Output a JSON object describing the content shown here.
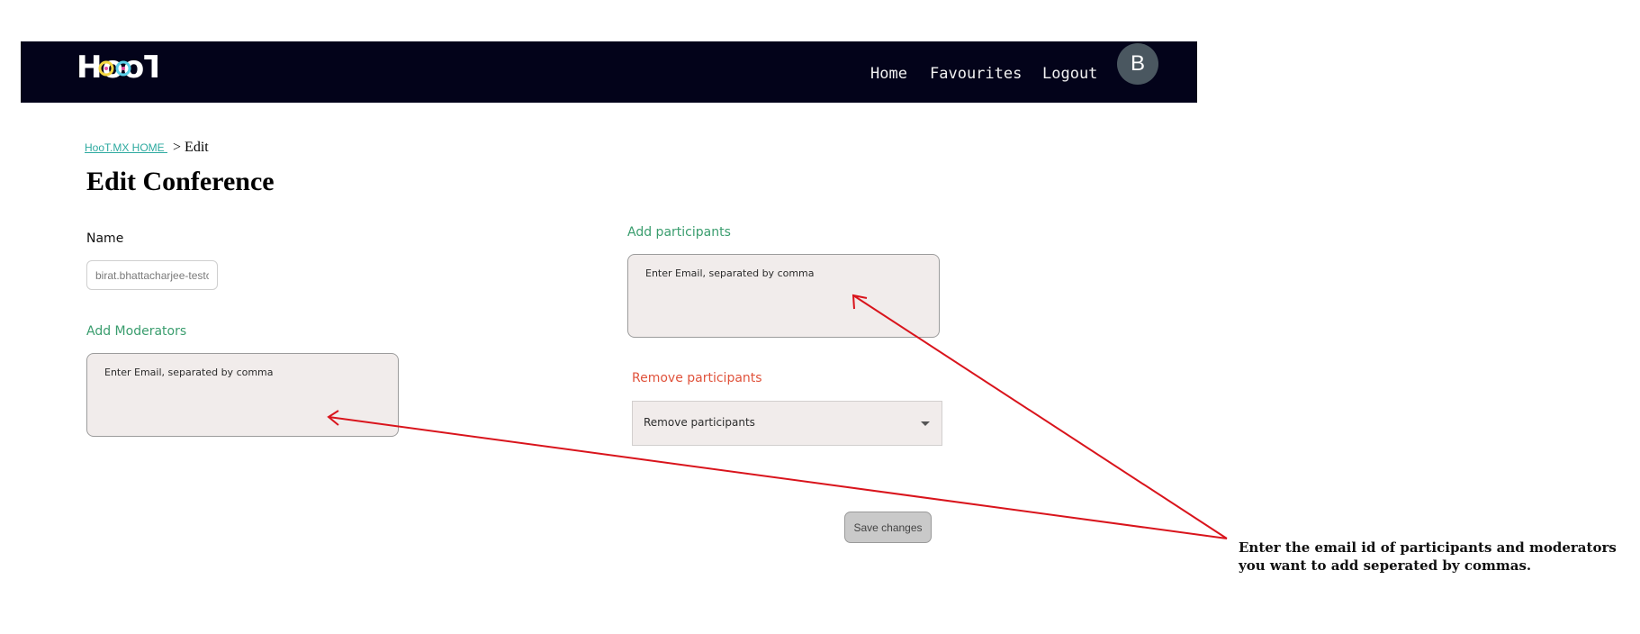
{
  "navbar": {
    "logo_text": "HooT",
    "links": {
      "home": "Home",
      "favourites": "Favourites",
      "logout": "Logout"
    },
    "avatar_initial": "B"
  },
  "breadcrumb": {
    "home_link": "HooT.MX HOME ",
    "current": "> Edit"
  },
  "page_title": "Edit Conference",
  "form": {
    "name_label": "Name",
    "name_value": "birat.bhattacharjee-testc",
    "moderators_label": "Add Moderators",
    "moderators_placeholder": "Enter Email, separated by comma",
    "participants_label": "Add participants",
    "participants_placeholder": "Enter Email, separated by comma",
    "remove_label": "Remove participants",
    "remove_select_value": "Remove participants",
    "save_button": "Save changes"
  },
  "annotation": {
    "text": "Enter the email id of participants and moderators you want to add seperated by commas.",
    "arrow_color": "#d9141c"
  },
  "colors": {
    "navbar_bg": "#03031a",
    "label_green": "#3a9d6e",
    "label_red": "#e0533c",
    "link_teal": "#2eaaa0"
  }
}
